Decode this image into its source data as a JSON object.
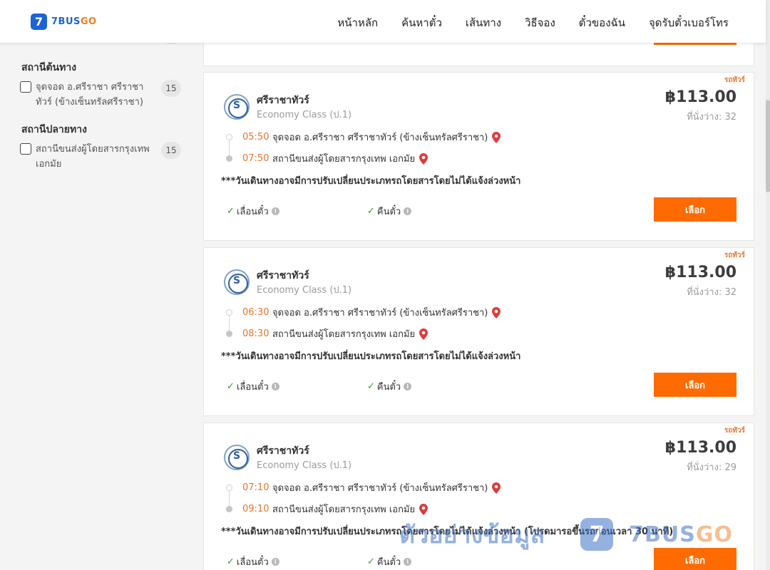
{
  "header": {
    "logo_mark": "7",
    "logo_text_a": "7BUS",
    "logo_text_b": "GO",
    "nav": [
      "หน้าหลัก",
      "ค้นหาตั๋ว",
      "เส้นทาง",
      "วิธีจอง",
      "ตั๋วของฉัน",
      "จุดรับตั๋วเบอร์โทร"
    ]
  },
  "sidebar": {
    "origin_title": "สถานีต้นทาง",
    "origin_item": {
      "label": "จุดจอด อ.ศรีราชา ศรีราชาทัวร์ (ข้างเซ็นทรัลศรีราชา)",
      "count": "15"
    },
    "dest_title": "สถานีปลายทาง",
    "dest_item": {
      "label": "สถานีขนส่งผู้โดยสารกรุงเทพ เอกมัย",
      "count": "15"
    }
  },
  "trips": [
    {
      "tag": "รถทัวร์",
      "operator": "ศรีราชาทัวร์",
      "class": "Economy Class (ป.1)",
      "price": "฿113.00",
      "seats": "ที่นั่งว่าง: 32",
      "dep_time": "05:50",
      "dep_stop": "จุดจอด อ.ศรีราชา ศรีราชาทัวร์ (ข้างเซ็นทรัลศรีราชา)",
      "arr_time": "07:50",
      "arr_stop": "สถานีขนส่งผู้โดยสารกรุงเทพ เอกมัย",
      "note": "***วันเดินทางอาจมีการปรับเปลี่ยนประเภทรถโดยสารโดยไม่ได้แจ้งล่วงหน้า",
      "feat1": "เลื่อนตั๋ว",
      "feat2": "คืนตั๋ว",
      "button": "เลือก"
    },
    {
      "tag": "รถทัวร์",
      "operator": "ศรีราชาทัวร์",
      "class": "Economy Class (ป.1)",
      "price": "฿113.00",
      "seats": "ที่นั่งว่าง: 32",
      "dep_time": "06:30",
      "dep_stop": "จุดจอด อ.ศรีราชา ศรีราชาทัวร์ (ข้างเซ็นทรัลศรีราชา)",
      "arr_time": "08:30",
      "arr_stop": "สถานีขนส่งผู้โดยสารกรุงเทพ เอกมัย",
      "note": "***วันเดินทางอาจมีการปรับเปลี่ยนประเภทรถโดยสารโดยไม่ได้แจ้งล่วงหน้า",
      "feat1": "เลื่อนตั๋ว",
      "feat2": "คืนตั๋ว",
      "button": "เลือก"
    },
    {
      "tag": "รถทัวร์",
      "operator": "ศรีราชาทัวร์",
      "class": "Economy Class (ป.1)",
      "price": "฿113.00",
      "seats": "ที่นั่งว่าง: 29",
      "dep_time": "07:10",
      "dep_stop": "จุดจอด อ.ศรีราชา ศรีราชาทัวร์ (ข้างเซ็นทรัลศรีราชา)",
      "arr_time": "09:10",
      "arr_stop": "สถานีขนส่งผู้โดยสารกรุงเทพ เอกมัย",
      "note": "***วันเดินทางอาจมีการปรับเปลี่ยนประเภทรถโดยสารโดยไม่ได้แจ้งล่วงหน้า (โปรดมารอขึ้นรถก่อนเวลา 30 นาที)",
      "feat1": "เลื่อนตั๋ว",
      "feat2": "คืนตั๋ว",
      "button": "เลือก"
    }
  ],
  "watermark": {
    "text": "ตัวอย่างข้อมูล",
    "mark": "7",
    "brand_a": "7BUS",
    "brand_b": "GO"
  },
  "colors": {
    "accent": "#ff6b00",
    "time": "#e8742c",
    "brand_blue": "#1e63d6",
    "check": "#2e9c3f",
    "pin": "#e03a3a"
  }
}
